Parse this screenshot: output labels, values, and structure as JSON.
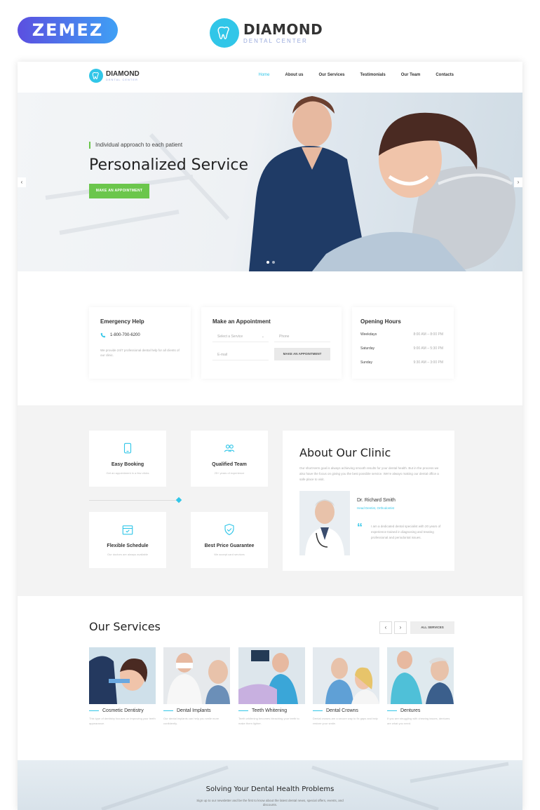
{
  "promo": {
    "vendor": "ZEMEZ",
    "brand_name": "DIAMOND",
    "brand_sub": "DENTAL CENTER"
  },
  "nav": {
    "logo_name": "DIAMOND",
    "logo_sub": "DENTAL CENTER",
    "items": [
      "Home",
      "About us",
      "Our Services",
      "Testimonials",
      "Our Team",
      "Contacts"
    ],
    "active": "Home"
  },
  "hero": {
    "tagline": "Individual approach to each patient",
    "title": "Personalized Service",
    "cta": "MAKE AN APPOINTMENT",
    "prev_arrow": "‹",
    "next_arrow": "›",
    "slides": 2,
    "active_slide": 1
  },
  "emergency": {
    "title": "Emergency Help",
    "phone": "1-800-700-6200",
    "text": "We provide 24/7 professional dental help for all clients of our clinic."
  },
  "appointment": {
    "title": "Make an Appointment",
    "service_placeholder": "Select a Service",
    "phone_placeholder": "Phone",
    "email_placeholder": "E-mail",
    "button": "MAKE AN APPOINTMENT"
  },
  "hours": {
    "title": "Opening Hours",
    "rows": [
      {
        "day": "Weekdays",
        "time": "8:00 AM – 8:00 PM"
      },
      {
        "day": "Saturday",
        "time": "9:00 AM – 5:30 PM"
      },
      {
        "day": "Sunday",
        "time": "9:30 AM – 3:00 PM"
      }
    ]
  },
  "features": [
    {
      "title": "Easy Booking",
      "sub": "Get an appointment in a few clicks",
      "icon": "tablet-icon"
    },
    {
      "title": "Qualified Team",
      "sub": "25+ years of experience",
      "icon": "team-icon"
    },
    {
      "title": "Flexible Schedule",
      "sub": "Our doctors are always available",
      "icon": "calendar-icon"
    },
    {
      "title": "Best Price Guarantee",
      "sub": "We accept card services",
      "icon": "shield-check-icon"
    }
  ],
  "about": {
    "title": "About Our Clinic",
    "text": "Our short-term goal is always achieving smooth results for your dental health. But in the process we also have the focus on giving you the best possible service. We're always making our dental office a safe place to visit.",
    "doctor_name": "Dr. Richard Smith",
    "doctor_role": "Head Dentist, Orthodontist",
    "quote_mark": "“",
    "quote": "I am a dedicated dental specialist with 20 years of experience trained in diagnosing and treating professional and periodontal issues."
  },
  "services": {
    "title": "Our Services",
    "all_label": "ALL SERVICES",
    "prev": "‹",
    "next": "›",
    "items": [
      {
        "title": "Cosmetic Dentistry",
        "text": "This type of dentistry focuses on improving your teeth appearance."
      },
      {
        "title": "Dental Implants",
        "text": "Our dental implants can help you smile more confidently."
      },
      {
        "title": "Teeth Whitening",
        "text": "Teeth whitening becomes bleaching your teeth to make them lighter."
      },
      {
        "title": "Dental Crowns",
        "text": "Dental crowns are a secure way to fix gaps and help restore your smile."
      },
      {
        "title": "Dentures",
        "text": "If you are struggling with chewing issues, dentures are what you need."
      }
    ]
  },
  "newsletter": {
    "title": "Solving Your Dental Health Problems",
    "text": "Sign up to our newsletter and be the first to know about the latest dental news, special offers, events, and discounts."
  },
  "colors": {
    "accent": "#31c6e8",
    "green": "#6bc64c",
    "grey_bg": "#f3f3f3"
  }
}
